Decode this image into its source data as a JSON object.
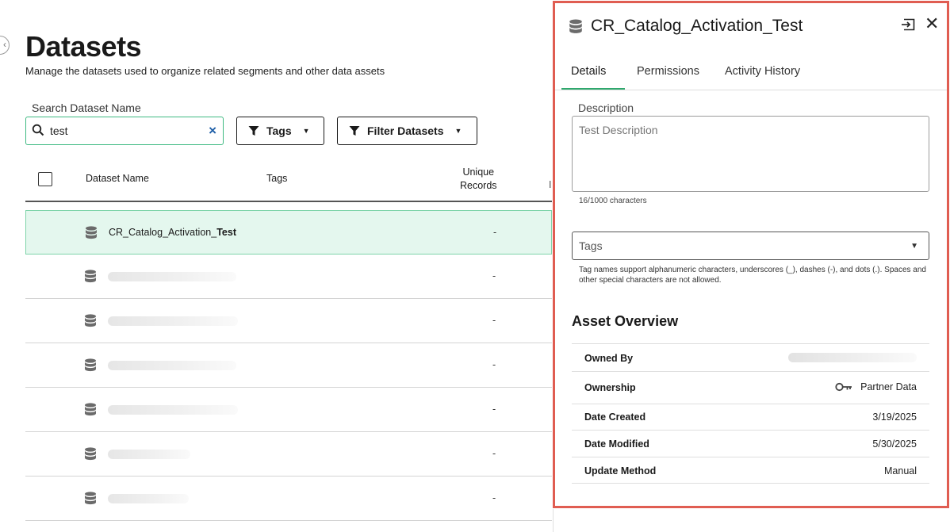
{
  "page": {
    "title": "Datasets",
    "subtitle": "Manage the datasets used to organize related segments and other data assets"
  },
  "search": {
    "label": "Search Dataset Name",
    "value": "test",
    "clear_symbol": "×"
  },
  "filters": {
    "tags_label": "Tags",
    "filter_label": "Filter Datasets"
  },
  "table": {
    "headers": {
      "name": "Dataset Name",
      "tags": "Tags",
      "unique_records_line1": "Unique",
      "unique_records_line2": "Records"
    },
    "rows": [
      {
        "name_prefix": "CR_Catalog_Activation_",
        "name_highlight": "Test",
        "unique_records": "-",
        "selected": true
      },
      {
        "name_prefix": "",
        "name_highlight": "",
        "unique_records": "-",
        "selected": false,
        "redacted": true
      },
      {
        "name_prefix": "",
        "name_highlight": "",
        "unique_records": "-",
        "selected": false,
        "redacted": true
      },
      {
        "name_prefix": "",
        "name_highlight": "",
        "unique_records": "-",
        "selected": false,
        "redacted": true
      },
      {
        "name_prefix": "",
        "name_highlight": "",
        "unique_records": "-",
        "selected": false,
        "redacted": true
      },
      {
        "name_prefix": "",
        "name_highlight": "",
        "unique_records": "-",
        "selected": false,
        "redacted": true
      },
      {
        "name_prefix": "",
        "name_highlight": "",
        "unique_records": "-",
        "selected": false,
        "redacted": true
      }
    ]
  },
  "panel": {
    "title": "CR_Catalog_Activation_Test",
    "tabs": [
      {
        "label": "Details",
        "active": true
      },
      {
        "label": "Permissions",
        "active": false
      },
      {
        "label": "Activity History",
        "active": false
      }
    ],
    "description": {
      "label": "Description",
      "placeholder": "Test Description",
      "char_count": "16/1000 characters"
    },
    "tags": {
      "label": "Tags",
      "help": "Tag names support alphanumeric characters, underscores (_), dashes (-), and dots (.). Spaces and other special characters are not allowed."
    },
    "asset_overview": {
      "title": "Asset Overview",
      "owned_by_label": "Owned By",
      "ownership_label": "Ownership",
      "ownership_value": "Partner Data",
      "date_created_label": "Date Created",
      "date_created_value": "3/19/2025",
      "date_modified_label": "Date Modified",
      "date_modified_value": "5/30/2025",
      "update_method_label": "Update Method",
      "update_method_value": "Manual"
    }
  },
  "icons": {
    "back": "back-arrow-icon",
    "search": "search-icon",
    "filter": "filter-icon",
    "database": "database-icon",
    "export": "export-icon",
    "close": "close-icon",
    "key": "key-icon",
    "caret": "caret-down-icon"
  },
  "colors": {
    "accent_green": "#2fa86d",
    "selected_row_bg": "#e4f7ee",
    "panel_highlight_border": "#e05d52",
    "clear_blue": "#1f5fa8"
  }
}
